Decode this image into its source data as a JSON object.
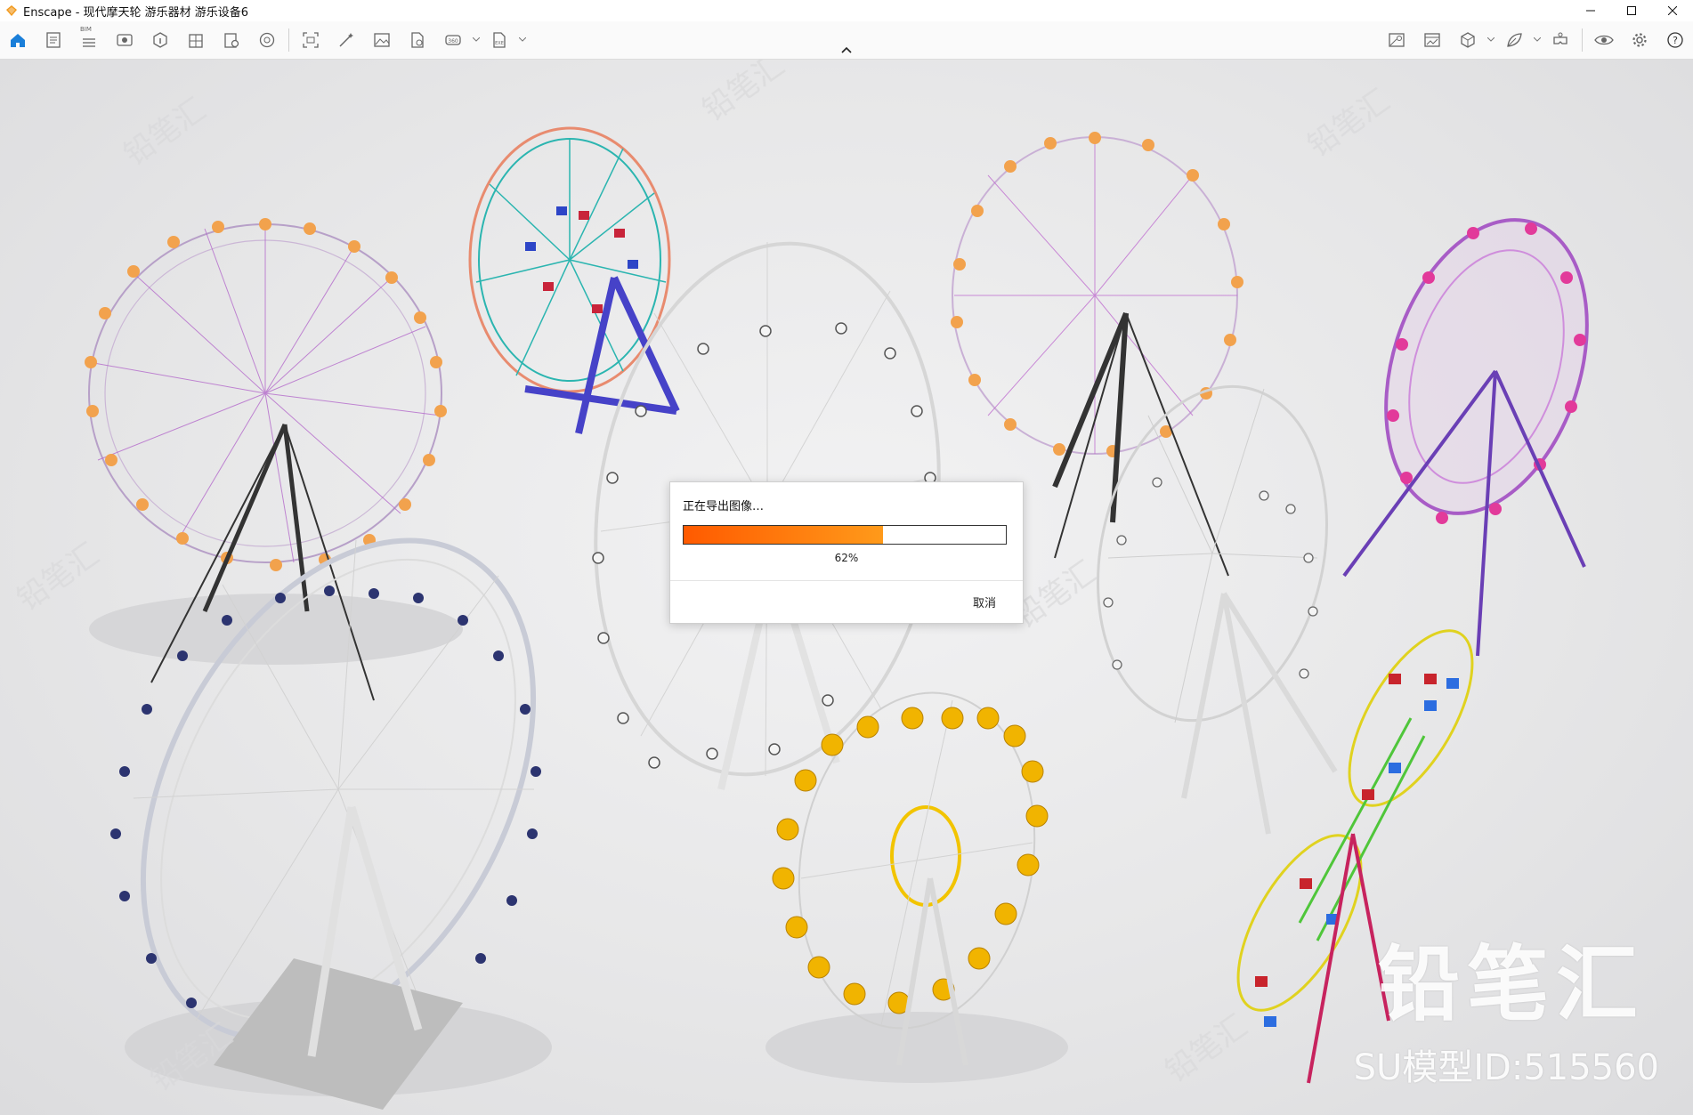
{
  "window": {
    "title": "Enscape - 现代摩天轮 游乐器材 游乐设备6",
    "app_icon": "enscape-logo-icon",
    "accent_color": "#f29a1f"
  },
  "toolbar": {
    "left_icons": [
      "home-icon",
      "document-icon",
      "bim-icon",
      "eye-icon",
      "cube-info-icon",
      "building-icon",
      "settings-file-icon",
      "sphere-icon",
      "screenshot-icon",
      "magic-wand-icon",
      "image-icon",
      "file-export-icon",
      "panorama-icon",
      "exe-export-icon"
    ],
    "bim_tag": "BIM",
    "right_icons": [
      "map-icon",
      "image-gallery-icon",
      "cube-icon",
      "leaf-icon",
      "vr-headset-icon",
      "visibility-icon",
      "gear-icon",
      "help-icon"
    ]
  },
  "dialog": {
    "title": "正在导出图像…",
    "progress": 62,
    "progress_label": "62%",
    "cancel_label": "取消",
    "progress_color_start": "#ff5a00",
    "progress_color_end": "#ff9a1a"
  },
  "watermark": {
    "brand": "铅笔汇",
    "model_id": "SU模型ID:515560"
  }
}
